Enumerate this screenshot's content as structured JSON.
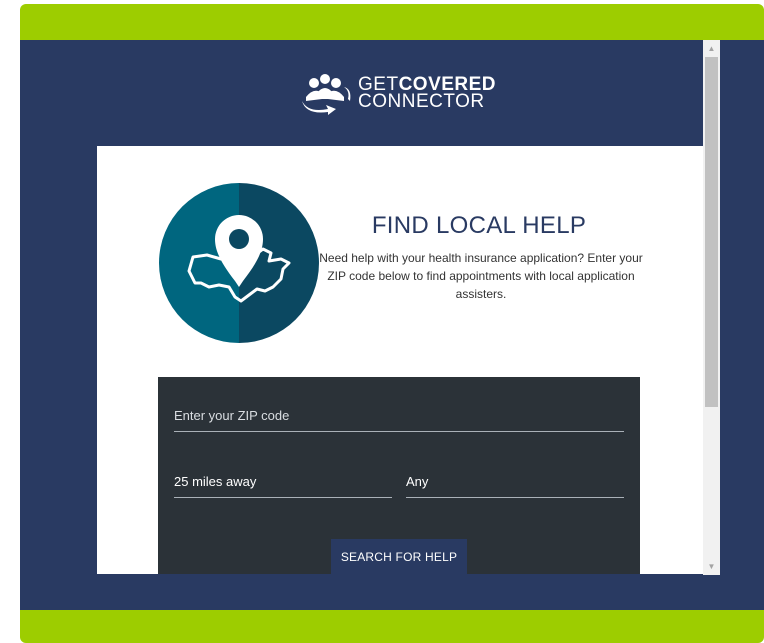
{
  "brand": {
    "line1_regular": "GET",
    "line1_bold": "COVERED",
    "line2": "CONNECTOR",
    "colors": {
      "navy": "#293a62",
      "lime": "#9dcd00",
      "teal": "#00667f",
      "panel": "#2b3238"
    }
  },
  "hero": {
    "icon": "map-pin-usa-icon",
    "title": "FIND LOCAL HELP",
    "description": "Need help with your health insurance application? Enter your ZIP code below to find appointments with local application assisters."
  },
  "search": {
    "zip_placeholder": "Enter your ZIP code",
    "distance_value": "25 miles away",
    "type_value": "Any",
    "button_label": "SEARCH FOR HELP"
  },
  "scrollbar": {
    "up_icon": "scroll-up-arrow-icon",
    "down_icon": "scroll-down-arrow-icon"
  }
}
